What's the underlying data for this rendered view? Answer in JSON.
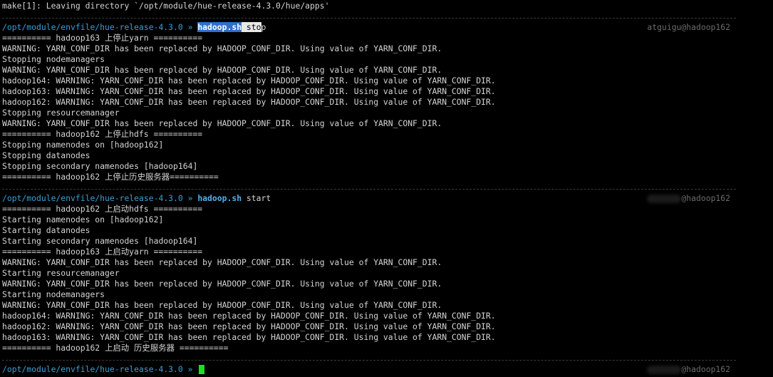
{
  "terminal": {
    "top_line": "make[1]: Leaving directory `/opt/module/hue-release-4.3.0/hue/apps'",
    "prompt1": {
      "path": "/opt/module/envfile/hue-release-4.3.0",
      "arrow": "»",
      "cmd_name": "hadoop.sh",
      "cmd_arg_a": " sto",
      "cmd_arg_b": "p",
      "host": "atguigu@hadoop162"
    },
    "stop_output": [
      "========== hadoop163 上停止yarn ==========",
      "WARNING: YARN_CONF_DIR has been replaced by HADOOP_CONF_DIR. Using value of YARN_CONF_DIR.",
      "Stopping nodemanagers",
      "WARNING: YARN_CONF_DIR has been replaced by HADOOP_CONF_DIR. Using value of YARN_CONF_DIR.",
      "hadoop164: WARNING: YARN_CONF_DIR has been replaced by HADOOP_CONF_DIR. Using value of YARN_CONF_DIR.",
      "hadoop163: WARNING: YARN_CONF_DIR has been replaced by HADOOP_CONF_DIR. Using value of YARN_CONF_DIR.",
      "hadoop162: WARNING: YARN_CONF_DIR has been replaced by HADOOP_CONF_DIR. Using value of YARN_CONF_DIR.",
      "Stopping resourcemanager",
      "WARNING: YARN_CONF_DIR has been replaced by HADOOP_CONF_DIR. Using value of YARN_CONF_DIR.",
      "========== hadoop162 上停止hdfs ==========",
      "Stopping namenodes on [hadoop162]",
      "Stopping datanodes",
      "Stopping secondary namenodes [hadoop164]",
      "========== hadoop162 上停止历史服务器=========="
    ],
    "prompt2": {
      "path": "/opt/module/envfile/hue-release-4.3.0",
      "arrow": "»",
      "cmd_name": "hadoop.sh",
      "cmd_arg": " start",
      "host": "@hadoop162"
    },
    "start_output": [
      "========== hadoop162 上启动hdfs ==========",
      "Starting namenodes on [hadoop162]",
      "Starting datanodes",
      "Starting secondary namenodes [hadoop164]",
      "========== hadoop163 上启动yarn ==========",
      "WARNING: YARN_CONF_DIR has been replaced by HADOOP_CONF_DIR. Using value of YARN_CONF_DIR.",
      "Starting resourcemanager",
      "WARNING: YARN_CONF_DIR has been replaced by HADOOP_CONF_DIR. Using value of YARN_CONF_DIR.",
      "Starting nodemanagers",
      "WARNING: YARN_CONF_DIR has been replaced by HADOOP_CONF_DIR. Using value of YARN_CONF_DIR.",
      "hadoop164: WARNING: YARN_CONF_DIR has been replaced by HADOOP_CONF_DIR. Using value of YARN_CONF_DIR.",
      "hadoop162: WARNING: YARN_CONF_DIR has been replaced by HADOOP_CONF_DIR. Using value of YARN_CONF_DIR.",
      "hadoop163: WARNING: YARN_CONF_DIR has been replaced by HADOOP_CONF_DIR. Using value of YARN_CONF_DIR.",
      "========== hadoop162 上启动 历史服务器 =========="
    ],
    "prompt3": {
      "path": "/opt/module/envfile/hue-release-4.3.0",
      "arrow": "»",
      "host": "@hadoop162"
    },
    "colors": {
      "background": "#000000",
      "text": "#d4d4d4",
      "path": "#3a9fd6",
      "command": "#4fb1ea",
      "selection": "#2f6fcc",
      "cursor": "#19e01e",
      "host": "#6b6b6b"
    }
  }
}
